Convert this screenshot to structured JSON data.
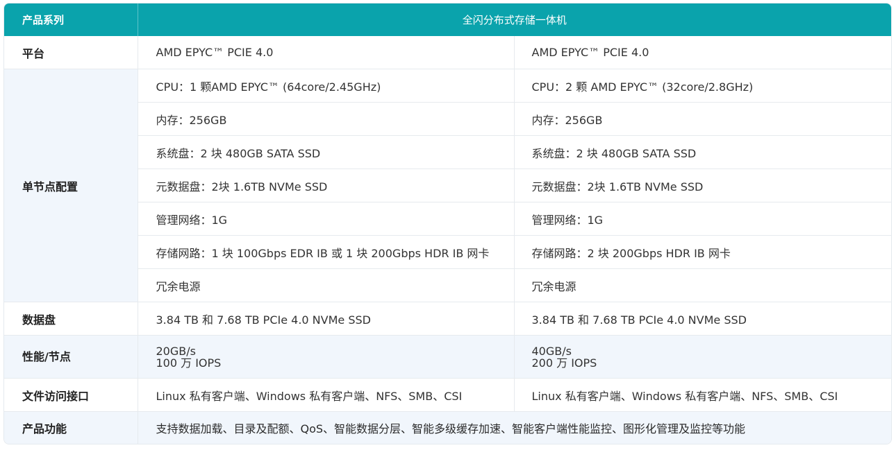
{
  "header": {
    "series_label": "产品系列",
    "product_name": "全闪分布式存储一体机"
  },
  "rows": {
    "platform": {
      "label": "平台",
      "a": "AMD EPYC™ PCIE 4.0",
      "b": "AMD EPYC™ PCIE 4.0"
    },
    "node_config": {
      "label": "单节点配置",
      "items": [
        {
          "a": "CPU：1 颗AMD EPYC™ (64core/2.45GHz)",
          "b": "CPU：2 颗 AMD EPYC™ (32core/2.8GHz)"
        },
        {
          "a": "内存：256GB",
          "b": "内存：256GB"
        },
        {
          "a": "系统盘：2 块 480GB SATA SSD",
          "b": "系统盘：2 块 480GB SATA SSD"
        },
        {
          "a": "元数据盘：2块 1.6TB NVMe SSD",
          "b": "元数据盘：2块 1.6TB NVMe SSD"
        },
        {
          "a": "管理网络：1G",
          "b": "管理网络：1G"
        },
        {
          "a": "存储网路：1 块 100Gbps EDR IB 或 1 块 200Gbps HDR IB 网卡",
          "b": "存储网路：2 块 200Gbps HDR IB 网卡"
        },
        {
          "a": "冗余电源",
          "b": "冗余电源"
        }
      ]
    },
    "data_disk": {
      "label": "数据盘",
      "a": "3.84 TB 和 7.68 TB PCIe 4.0 NVMe SSD",
      "b": "3.84 TB 和 7.68 TB PCIe 4.0 NVMe SSD"
    },
    "performance": {
      "label": "性能/节点",
      "a_line1": "20GB/s",
      "a_line2": "100 万 IOPS",
      "b_line1": "40GB/s",
      "b_line2": "200 万 IOPS"
    },
    "file_access": {
      "label": "文件访问接口",
      "a": "Linux 私有客户端、Windows 私有客户端、NFS、SMB、CSI",
      "b": "Linux 私有客户端、Windows 私有客户端、NFS、SMB、CSI"
    },
    "features": {
      "label": "产品功能",
      "value": "支持数据加载、目录及配额、QoS、智能数据分层、智能多级缓存加速、智能客户端性能监控、图形化管理及监控等功能"
    }
  }
}
